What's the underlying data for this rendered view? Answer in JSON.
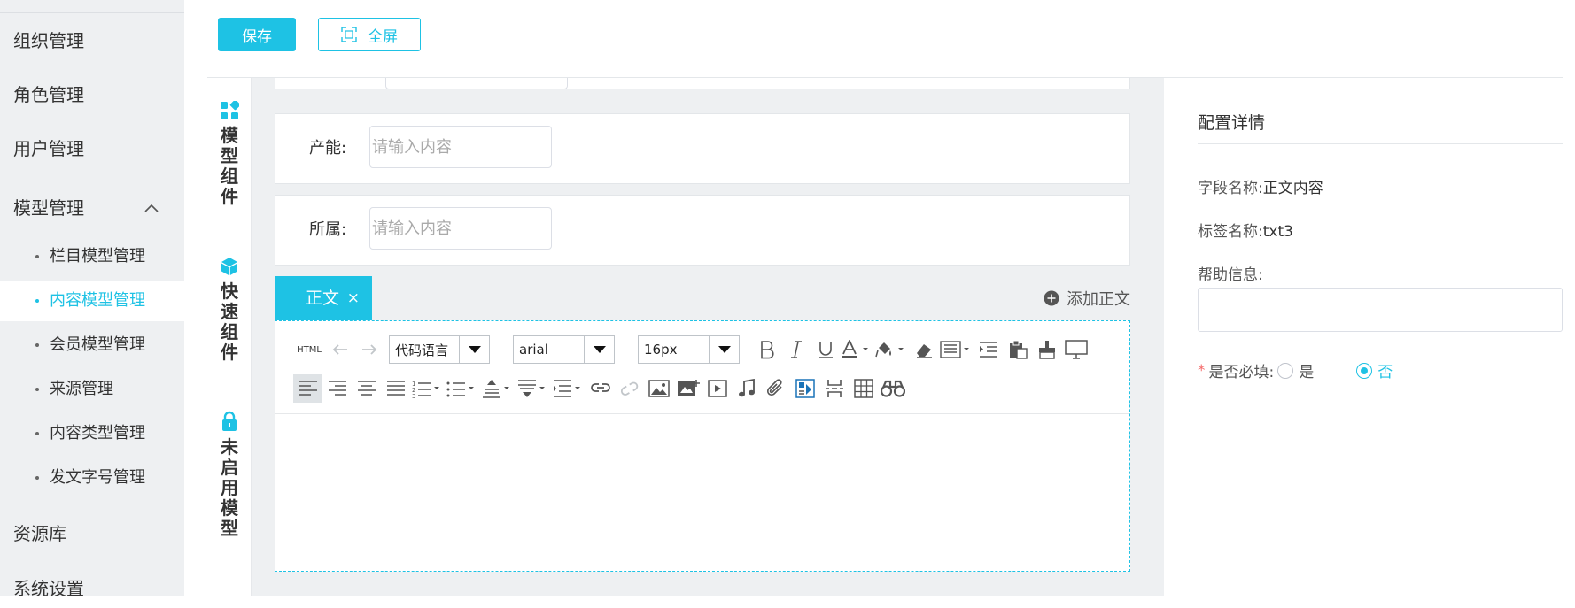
{
  "sidebar": {
    "items": [
      {
        "label": "组织管理"
      },
      {
        "label": "角色管理"
      },
      {
        "label": "用户管理"
      },
      {
        "label": "模型管理",
        "chevron": "chevron-up-icon"
      },
      {
        "label": "资源库"
      },
      {
        "label": "系统设置"
      }
    ],
    "sub_items": [
      {
        "label": "栏目模型管理"
      },
      {
        "label": "内容模型管理",
        "active": true
      },
      {
        "label": "会员模型管理"
      },
      {
        "label": "来源管理"
      },
      {
        "label": "内容类型管理"
      },
      {
        "label": "发文字号管理"
      }
    ]
  },
  "toolbar": {
    "save_label": "保存",
    "fullscreen_label": "全屏",
    "fullscreen_icon": "fullscreen-icon"
  },
  "vertical_tabs": [
    {
      "label": "模型组件",
      "icon": "grid-icon"
    },
    {
      "label": "快速组件",
      "icon": "cube-icon"
    },
    {
      "label": "未启用模型",
      "icon": "lock-icon"
    }
  ],
  "form": {
    "fields": [
      {
        "label": "产能:",
        "placeholder": "请输入内容",
        "value": ""
      },
      {
        "label": "所属:",
        "placeholder": "请输入内容",
        "value": ""
      }
    ],
    "active_tab": "正文",
    "tab_close": "×",
    "add_body_label": "添加正文"
  },
  "editor": {
    "html_label": "HTML",
    "code_lang_value": "代码语言",
    "font_value": "arial",
    "size_value": "16px"
  },
  "panel": {
    "title": "配置详情",
    "field_name_label": "字段名称:",
    "field_name_value": "正文内容",
    "tag_name_label": "标签名称:",
    "tag_name_value": "txt3",
    "help_label": "帮助信息:",
    "required_label": "是否必填:",
    "required_star": "*",
    "opt_yes": "是",
    "opt_no": "否",
    "selected": "否"
  },
  "colors": {
    "accent": "#1ec2e4",
    "sidebar_bg": "#eef0f2",
    "content_bg": "#eef0f2",
    "required": "#f56c6c"
  }
}
